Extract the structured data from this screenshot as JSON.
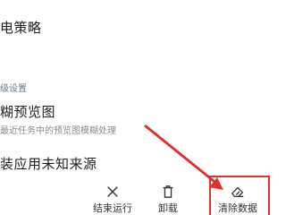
{
  "settings": {
    "item_power_policy": "电策略",
    "section_header": "级设置",
    "item_blur_preview": {
      "title": "糊预览图",
      "subtitle": "最近任务中的预览图模糊处理"
    },
    "item_unknown_sources": "装应用未知来源"
  },
  "actionbar": {
    "end_run": "结束运行",
    "uninstall": "卸载",
    "clear_data": "清除数据"
  },
  "icons": {
    "end_run": "close-icon",
    "uninstall": "trash-icon",
    "clear_data": "eraser-icon"
  },
  "colors": {
    "annotation": "#e0322c",
    "section_header": "#6b7a99"
  }
}
